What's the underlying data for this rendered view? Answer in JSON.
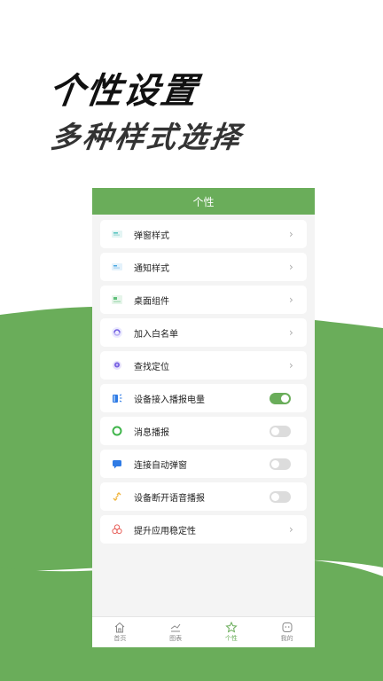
{
  "hero": {
    "title": "个性设置",
    "subtitle": "多种样式选择"
  },
  "screen": {
    "header_title": "个性",
    "items": [
      {
        "label": "弹窗样式",
        "icon": "popup-window-icon",
        "control": "chevron"
      },
      {
        "label": "通知样式",
        "icon": "notification-card-icon",
        "control": "chevron"
      },
      {
        "label": "桌面组件",
        "icon": "desktop-widget-icon",
        "control": "chevron"
      },
      {
        "label": "加入白名单",
        "icon": "whitelist-ring-icon",
        "control": "chevron"
      },
      {
        "label": "查找定位",
        "icon": "location-pin-icon",
        "control": "chevron"
      },
      {
        "label": "设备接入播报电量",
        "icon": "battery-speaker-icon",
        "control": "toggle",
        "on": true
      },
      {
        "label": "消息播报",
        "icon": "message-ring-icon",
        "control": "toggle",
        "on": false
      },
      {
        "label": "连接自动弹窗",
        "icon": "chat-bubble-icon",
        "control": "toggle",
        "on": false
      },
      {
        "label": "设备断开语音播报",
        "icon": "unlink-icon",
        "control": "toggle",
        "on": false
      },
      {
        "label": "提升应用稳定性",
        "icon": "stability-circles-icon",
        "control": "chevron"
      }
    ],
    "tabs": [
      {
        "label": "首页",
        "icon": "home-icon",
        "active": false
      },
      {
        "label": "图表",
        "icon": "chart-icon",
        "active": false
      },
      {
        "label": "个性",
        "icon": "personalize-icon",
        "active": true
      },
      {
        "label": "我的",
        "icon": "profile-icon",
        "active": false
      }
    ]
  },
  "colors": {
    "accent": "#6aad5a",
    "background_band": "#6aad5a"
  }
}
